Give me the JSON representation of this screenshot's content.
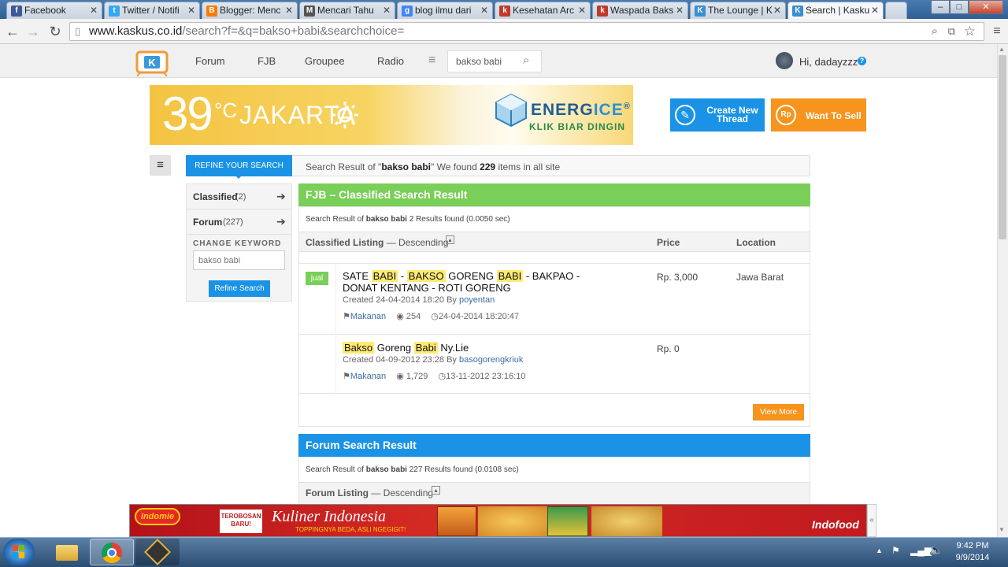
{
  "browser": {
    "tabs": [
      {
        "label": "Facebook",
        "icon": "facebook-icon",
        "color": "#3b5998",
        "glyph": "f"
      },
      {
        "label": "Twitter / Notifi",
        "icon": "twitter-icon",
        "color": "#33aaf0",
        "glyph": "t"
      },
      {
        "label": "Blogger: Menc",
        "icon": "blogger-icon",
        "color": "#f57d00",
        "glyph": "B"
      },
      {
        "label": "Mencari Tahu",
        "icon": "page-icon",
        "color": "#555555",
        "glyph": "M"
      },
      {
        "label": "blog ilmu dari",
        "icon": "google-icon",
        "color": "#4285f4",
        "glyph": "g"
      },
      {
        "label": "Kesehatan Arc",
        "icon": "kaskus-hot-icon",
        "color": "#c0392b",
        "glyph": "k"
      },
      {
        "label": "Waspada Baks",
        "icon": "kaskus-hot-icon",
        "color": "#c0392b",
        "glyph": "k"
      },
      {
        "label": "The Lounge | K",
        "icon": "kaskus-icon",
        "color": "#3a8fd0",
        "glyph": "K"
      },
      {
        "label": "Search | Kasku",
        "icon": "kaskus-icon",
        "color": "#3a8fd0",
        "glyph": "K"
      }
    ],
    "url_host": "www.kaskus.co.id",
    "url_path": "/search?f=&q=bakso+babi&searchchoice="
  },
  "site": {
    "nav": [
      "Forum",
      "FJB",
      "Groupee",
      "Radio"
    ],
    "search_value": "bakso babi",
    "greeting": "Hi, dadayzzz",
    "help": "?"
  },
  "banner": {
    "temp": "39",
    "deg": "°C",
    "city": "JAKARTA",
    "brand_pre": "ENERG",
    "brand_post": "ICE",
    "reg": "®",
    "tagline": "KLIK BIAR DINGIN"
  },
  "cta": {
    "create": "Create New Thread",
    "sell": "Want To Sell",
    "rp": "Rp"
  },
  "refine": {
    "tab": "REFINE YOUR SEARCH",
    "summary_pre": "Search Result of \"",
    "query": "bakso babi",
    "summary_mid": "\" We found ",
    "count": "229",
    "summary_post": " items in all site",
    "filters": [
      {
        "label": "Classified",
        "count": "(2)"
      },
      {
        "label": "Forum",
        "count": "(227)"
      }
    ],
    "change_kw": "CHANGE KEYWORD",
    "kw_placeholder": "bakso babi",
    "button": "Refine Search"
  },
  "fjb": {
    "title": "FJB – Classified Search Result",
    "result_pre": "Search Result of ",
    "result_q": "bakso babi",
    "result_post": " 2 Results found (0.0050 sec)",
    "col_listing": "Classified Listing",
    "col_order": " — Descending",
    "col_price": "Price",
    "col_location": "Location",
    "items": [
      {
        "badge": "jual",
        "title_parts": [
          "SATE ",
          "BABI",
          " - ",
          "BAKSO",
          " GORENG ",
          "BABI",
          " - BAKPAO - DONAT KENTANG - ROTI GORENG"
        ],
        "created": "Created 24-04-2014 18:20 By ",
        "author": "poyentan",
        "category": "Makanan",
        "views": "254",
        "updated": "24-04-2014 18:20:47",
        "price": "Rp. 3,000",
        "location": "Jawa Barat"
      },
      {
        "badge": "",
        "title_parts": [
          "Bakso",
          " Goreng ",
          "Babi",
          " Ny.Lie"
        ],
        "created": "Created 04-09-2012 23:28 By ",
        "author": "basogorengkriuk",
        "category": "Makanan",
        "views": "1,729",
        "updated": "13-11-2012 23:16:10",
        "price": "Rp. 0",
        "location": ""
      }
    ],
    "view_more": "View More"
  },
  "forum": {
    "title": "Forum Search Result",
    "result_pre": "Search Result of ",
    "result_q": "bakso babi",
    "result_post": " 227 Results found (0.0108 sec)",
    "col_listing": "Forum Listing",
    "col_order": " — Descending"
  },
  "ad": {
    "brand": "Indomie",
    "badge": "TEROBOSAN BARU!",
    "headline": "Kuliner Indonesia",
    "sub": "TOPPINGNYA BEDA, ASLI NGEGIGIT!",
    "maker": "Indofood"
  },
  "taskbar": {
    "time": "9:42 PM",
    "date": "9/9/2014"
  },
  "colors": {
    "fjb_green": "#79cf57",
    "forum_blue": "#1a93e6",
    "accent_orange": "#f7941d",
    "link_blue": "#3a6ea5"
  }
}
